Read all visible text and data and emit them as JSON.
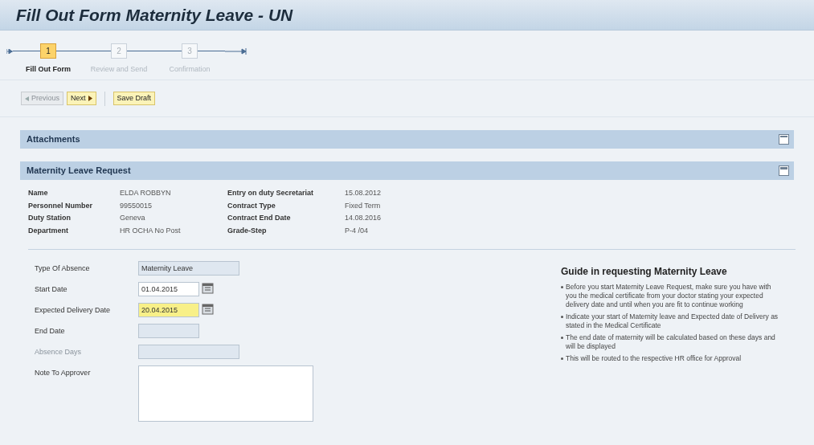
{
  "title": "Fill Out Form Maternity Leave - UN",
  "steps": [
    {
      "number": "1",
      "label": "Fill Out Form",
      "selected": true
    },
    {
      "number": "2",
      "label": "Review and Send",
      "selected": false
    },
    {
      "number": "3",
      "label": "Confirmation",
      "selected": false
    }
  ],
  "toolbar": [
    {
      "label": "Previous",
      "kind": "previous",
      "disabled": true
    },
    {
      "label": "Next",
      "kind": "next",
      "disabled": false
    },
    {
      "label": "Save Draft",
      "kind": "plain",
      "disabled": false
    }
  ],
  "panels": [
    {
      "title": "Attachments",
      "expanded": false
    },
    {
      "title": "Maternity Leave Request",
      "expanded": true
    }
  ],
  "employee_info": [
    [
      {
        "label": "Name",
        "value": "ELDA ROBBYN"
      },
      {
        "label": "Personnel Number",
        "value": "99550015"
      },
      {
        "label": "Duty Station",
        "value": "Geneva"
      },
      {
        "label": "Department",
        "value": "HR OCHA No Post"
      }
    ],
    [
      {
        "label": "Entry on duty Secretariat",
        "value": "15.08.2012"
      },
      {
        "label": "Contract Type",
        "value": "Fixed Term"
      },
      {
        "label": "Contract End Date",
        "value": "14.08.2016"
      },
      {
        "label": "Grade-Step",
        "value": "P-4 /04"
      }
    ]
  ],
  "form_fields": [
    {
      "label": "Type Of Absence",
      "kind": "readonly",
      "value": "Maternity Leave",
      "disabled": false,
      "required": false
    },
    {
      "label": "Start Date",
      "kind": "date",
      "value": "01.04.2015",
      "disabled": false,
      "required": false
    },
    {
      "label": "Expected Delivery Date",
      "kind": "date",
      "value": "20.04.2015",
      "disabled": false,
      "required": true
    },
    {
      "label": "End Date",
      "kind": "readonly-short",
      "disabled": false,
      "required": false
    },
    {
      "label": "Absence Days",
      "kind": "readonly",
      "disabled": true,
      "required": false
    },
    {
      "label": "Note To Approver",
      "kind": "textarea",
      "disabled": false,
      "required": false
    }
  ],
  "guide": {
    "title": "Guide in requesting Maternity Leave",
    "items": [
      "Before you start Maternity Leave Request, make sure you have with you the medical certificate from your doctor stating your expected delivery date and until when you are fit to continue working",
      "Indicate your start of Maternity leave and Expected date of Delivery as stated in the Medical Certificate",
      "The end date of maternity will be calculated based on these days and will be displayed",
      "This will be routed to the respective HR office for Approval"
    ]
  }
}
